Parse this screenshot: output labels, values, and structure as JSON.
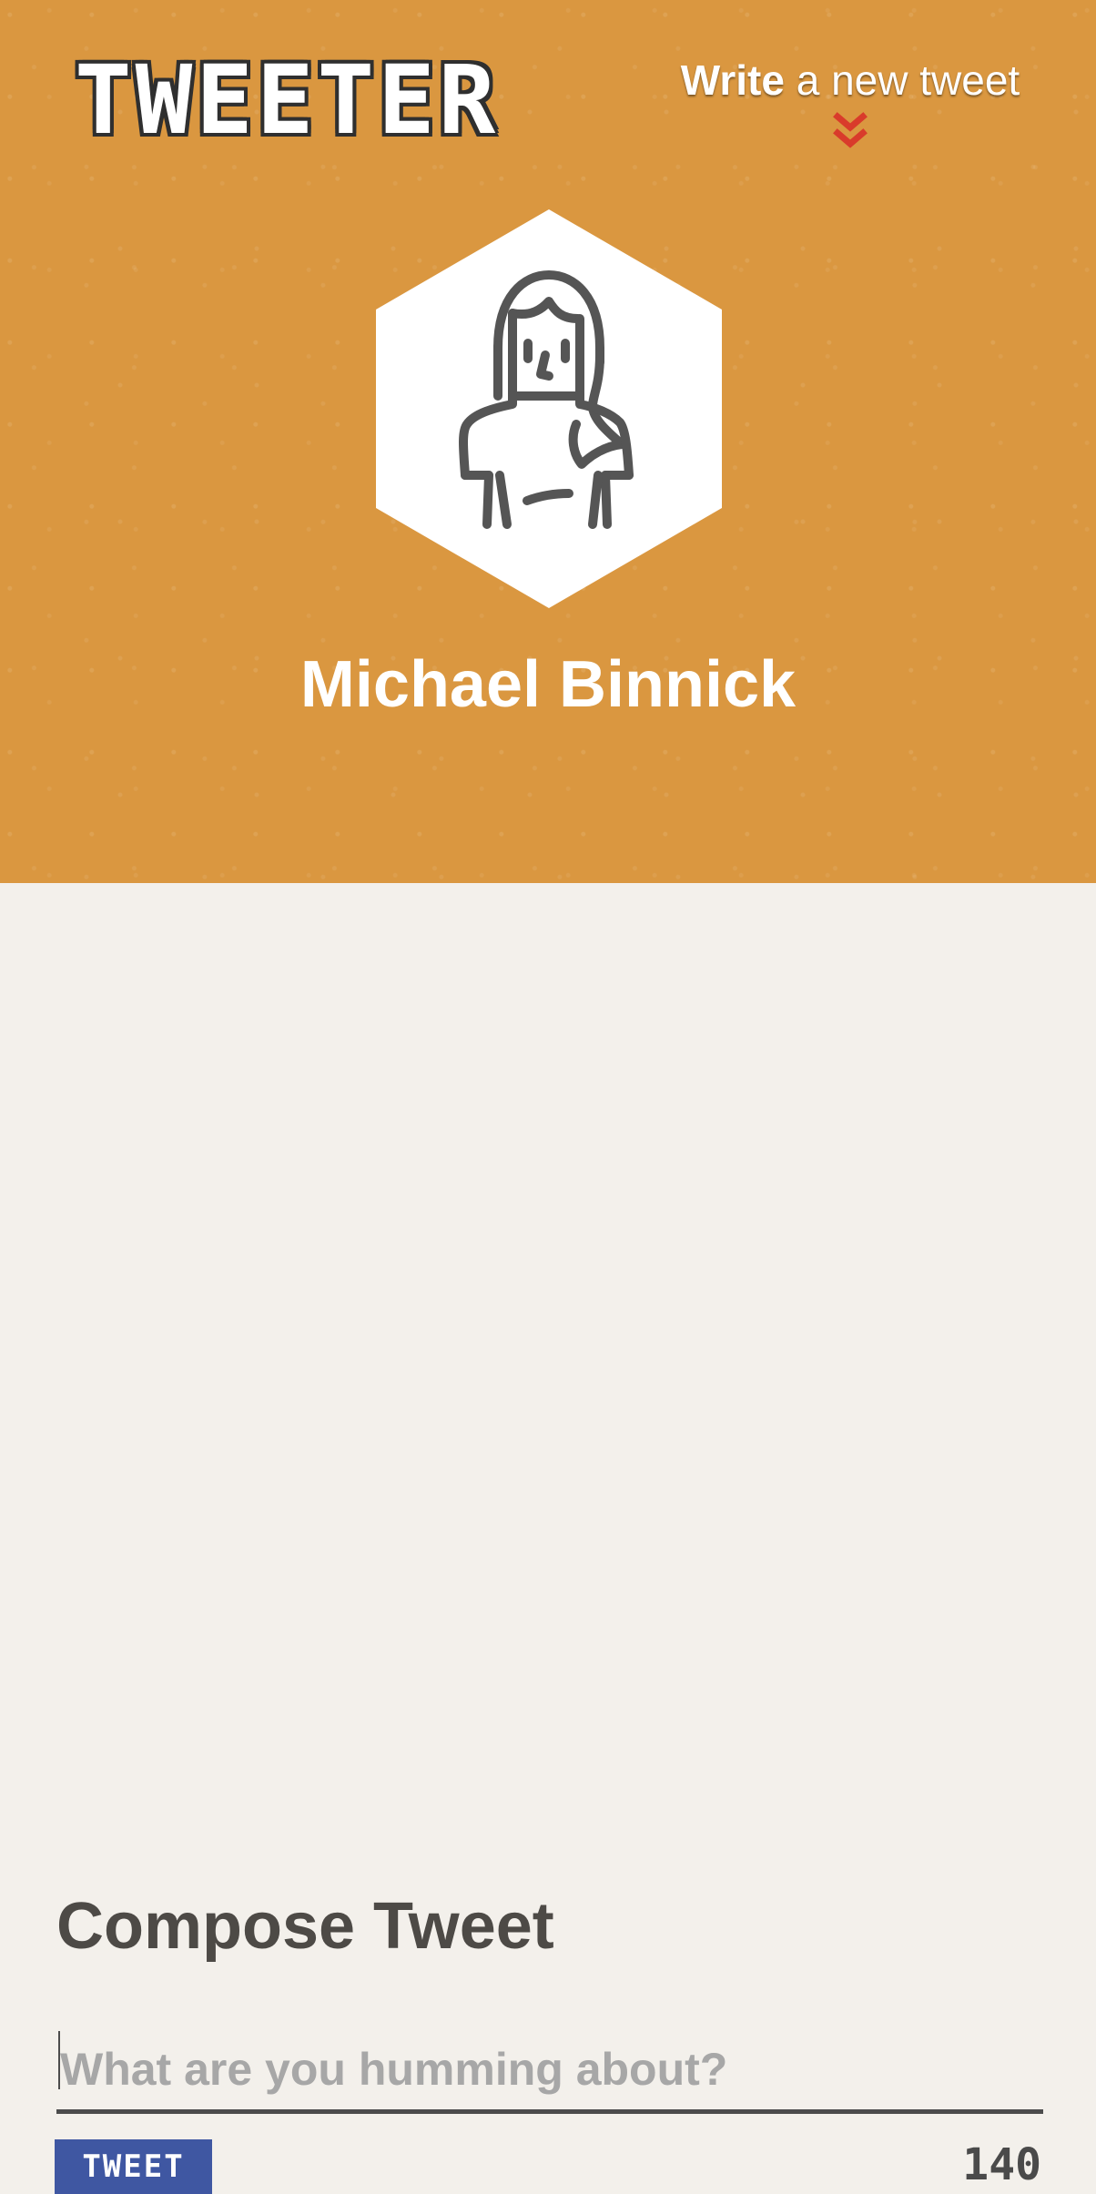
{
  "header": {
    "logo_text": "TWEETER",
    "write_prompt_strong": "Write",
    "write_prompt_rest": " a new tweet",
    "chevron_icon": "double-chevron-down-icon",
    "chevron_color": "#d93b2b"
  },
  "profile": {
    "name": "Michael Binnick",
    "avatar_icon": "woman-avatar-icon",
    "background_color": "#d9953c"
  },
  "compose": {
    "title": "Compose Tweet",
    "placeholder": "What are you humming about?",
    "button_label": "TWEET",
    "counter": "140",
    "button_color": "#3f57a2"
  }
}
